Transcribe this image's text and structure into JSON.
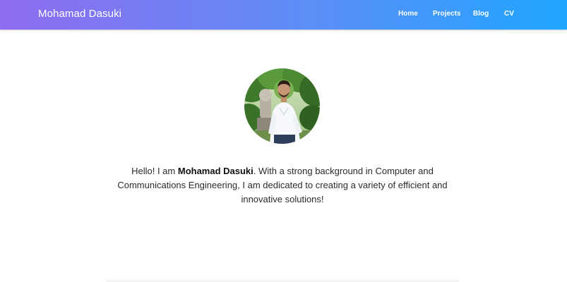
{
  "navbar": {
    "brand": "Mohamad Dasuki",
    "links": [
      {
        "label": "Home"
      },
      {
        "label": "Projects"
      },
      {
        "label": "Blog"
      },
      {
        "label": "CV"
      }
    ],
    "gradient_start": "#8f6cf0",
    "gradient_end": "#1fa6ff"
  },
  "hero": {
    "avatar_alt": "profile-photo",
    "intro_prefix": "Hello! I am ",
    "intro_name": "Mohamad Dasuki",
    "intro_suffix": ". With a strong background in Computer and Communications Engineering, I am dedicated to creating a variety of efficient and innovative solutions!"
  }
}
